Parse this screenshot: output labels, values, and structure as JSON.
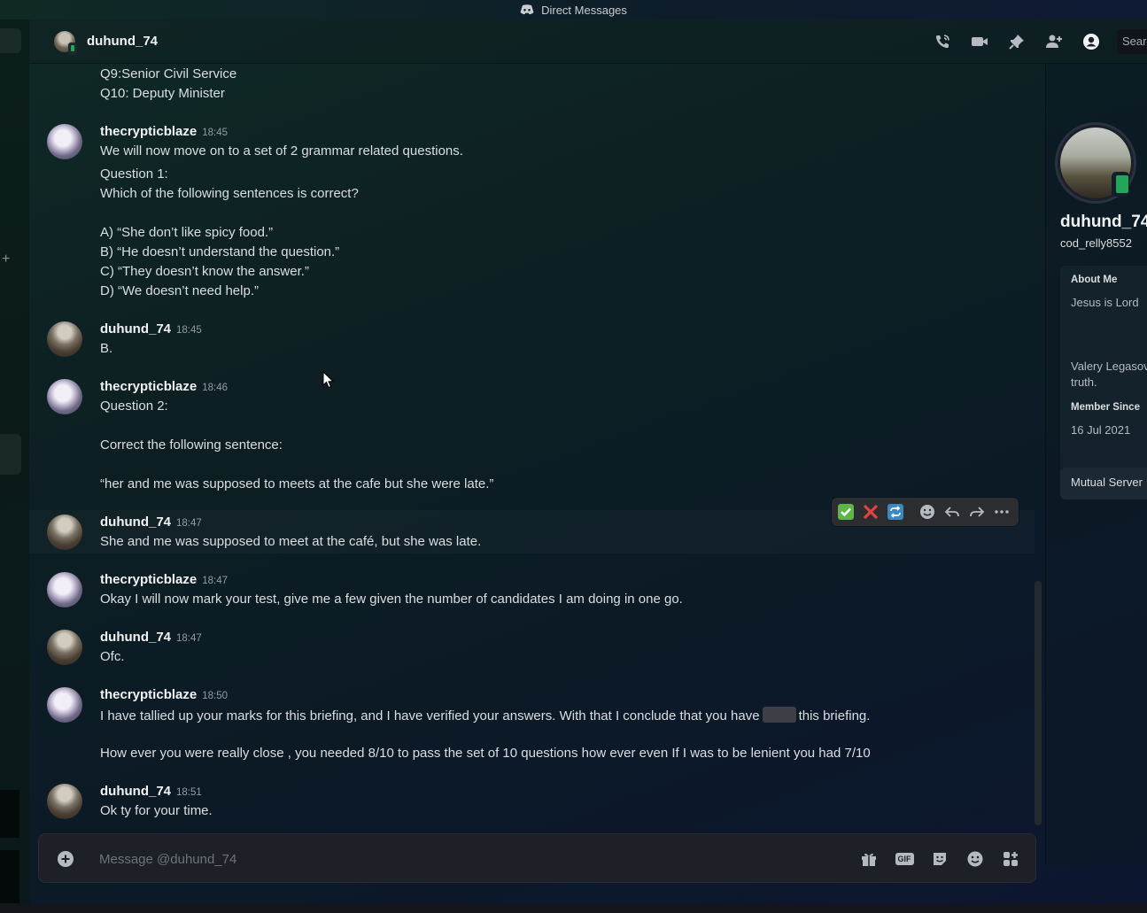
{
  "titlebar": {
    "title": "Direct Messages"
  },
  "header": {
    "name": "duhund_74",
    "search_placeholder": "Sear"
  },
  "messages": {
    "prev_line1": "Q9:Senior Civil Service",
    "prev_line2": "Q10: Deputy Minister",
    "m1": {
      "author": "thecrypticblaze",
      "time": "18:45",
      "l1": "We will now move on to a set of 2 grammar related questions.",
      "l2": "Question 1:",
      "l3": "Which of the following sentences is correct?",
      "l4": "A) “She don’t like spicy food.”",
      "l5": "B) “He doesn’t understand the question.”",
      "l6": "C) “They doesn’t know the answer.”",
      "l7": "D) “We doesn’t need help.”"
    },
    "m2": {
      "author": "duhund_74",
      "time": "18:45",
      "l1": "B."
    },
    "m3": {
      "author": "thecrypticblaze",
      "time": "18:46",
      "l1": "Question 2:",
      "l2": "Correct the following sentence:",
      "l3": "“her and me was supposed to meets at the cafe but she were late.”"
    },
    "m4": {
      "author": "duhund_74",
      "time": "18:47",
      "l1": "She and me was supposed to meet at the café, but she was late."
    },
    "m5": {
      "author": "thecrypticblaze",
      "time": "18:47",
      "l1": "Okay I will now mark your test, give me a few given the number of candidates I am doing in one go."
    },
    "m6": {
      "author": "duhund_74",
      "time": "18:47",
      "l1": "Ofc."
    },
    "m7": {
      "author": "thecrypticblaze",
      "time": "18:50",
      "l1a": "I have tallied up your marks for this briefing, and I have verified your answers. With that I conclude that you have",
      "l1b": "this briefing.",
      "l2": "How ever you were really close , you needed 8/10 to pass the set of 10 questions how ever even If I was to be lenient you had 7/10"
    },
    "m8": {
      "author": "duhund_74",
      "time": "18:51",
      "l1": "Ok ty for your time."
    }
  },
  "composer": {
    "placeholder": "Message @duhund_74"
  },
  "profile": {
    "name": "duhund_74",
    "username": "cod_relly8552",
    "about_label": "About Me",
    "about_l1": "Jesus is Lord",
    "about_l2": "Valery Legasov",
    "about_l3": "truth.",
    "member_label": "Member Since",
    "member_date": "16 Jul 2021",
    "mutual_label": "Mutual Server"
  },
  "icons": {
    "titlebar": "discord-icon",
    "header": [
      "voice-call-icon",
      "video-call-icon",
      "pinned-messages-icon",
      "add-friends-to-dm-icon",
      "user-profile-icon"
    ],
    "toolbar": [
      "check-reaction-icon",
      "cross-reaction-icon",
      "repeat-reaction-icon",
      "add-reaction-icon",
      "reply-icon",
      "forward-icon",
      "more-icon"
    ],
    "composer": [
      "add-attachment-icon",
      "gift-icon",
      "gif-icon",
      "sticker-icon",
      "emoji-icon",
      "apps-icon"
    ]
  },
  "colors": {
    "online_green": "#23a55a",
    "text_primary": "#f2f3f5",
    "text_muted": "#949ba4"
  }
}
